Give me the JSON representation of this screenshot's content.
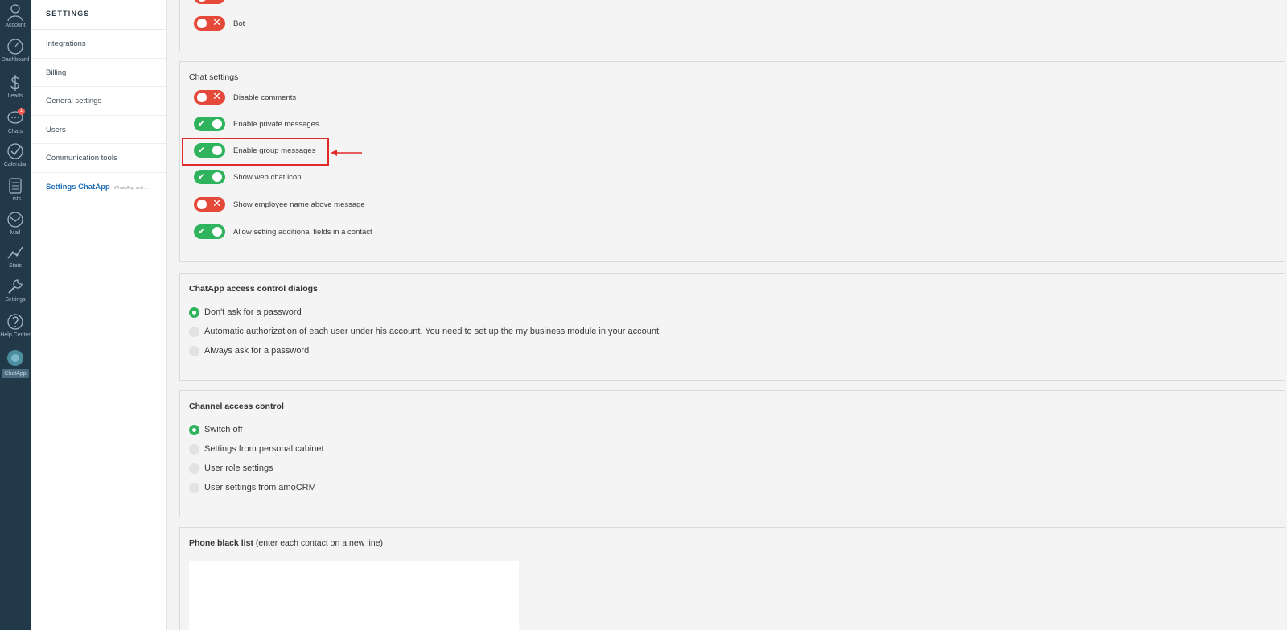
{
  "leftnav": {
    "items": [
      {
        "key": "account",
        "label": "Account",
        "icon": "user-icon"
      },
      {
        "key": "dashboard",
        "label": "Dashboard",
        "icon": "dashboard-gauge-icon"
      },
      {
        "key": "leads",
        "label": "Leads",
        "icon": "dollar-icon"
      },
      {
        "key": "chats",
        "label": "Chats",
        "icon": "chat-bubble-icon",
        "badge": "1"
      },
      {
        "key": "calendar",
        "label": "Calendar",
        "icon": "checkmark-circle-icon"
      },
      {
        "key": "lists",
        "label": "Lists",
        "icon": "list-document-icon"
      },
      {
        "key": "mail",
        "label": "Mail",
        "icon": "envelope-icon"
      },
      {
        "key": "stats",
        "label": "Stats",
        "icon": "line-chart-icon"
      },
      {
        "key": "settings",
        "label": "Settings",
        "icon": "wrench-icon"
      },
      {
        "key": "help",
        "label": "Help Center",
        "icon": "question-icon"
      },
      {
        "key": "chatapp",
        "label": "ChatApp",
        "icon": "chatapp-logo-icon"
      }
    ]
  },
  "sidebar": {
    "title": "SETTINGS",
    "items": [
      {
        "label": "Integrations"
      },
      {
        "label": "Billing"
      },
      {
        "label": "General settings"
      },
      {
        "label": "Users"
      },
      {
        "label": "Communication tools"
      }
    ],
    "active": {
      "label": "Settings ChatApp",
      "sub": "WhatsApp and ..."
    }
  },
  "top_card": {
    "toggles": [
      {
        "label": "Bot",
        "on": false
      }
    ]
  },
  "chat_settings": {
    "title": "Chat settings",
    "toggles": [
      {
        "label": "Disable comments",
        "on": false
      },
      {
        "label": "Enable private messages",
        "on": true
      },
      {
        "label": "Enable group messages",
        "on": true
      },
      {
        "label": "Show web chat icon",
        "on": true
      },
      {
        "label": "Show employee name above message",
        "on": false
      },
      {
        "label": "Allow setting additional fields in a contact",
        "on": true
      }
    ]
  },
  "access_dialogs": {
    "title": "ChatApp access control dialogs",
    "options": [
      {
        "label": "Don't ask for a password",
        "checked": true
      },
      {
        "label": "Automatic authorization of each user under his account. You need to set up the my business module in your account",
        "checked": false
      },
      {
        "label": "Always ask for a password",
        "checked": false
      }
    ]
  },
  "channel_access": {
    "title": "Channel access control",
    "options": [
      {
        "label": "Switch off",
        "checked": true
      },
      {
        "label": "Settings from personal cabinet",
        "checked": false
      },
      {
        "label": "User role settings",
        "checked": false
      },
      {
        "label": "User settings from amoCRM",
        "checked": false
      }
    ]
  },
  "blacklist": {
    "title": "Phone black list",
    "hint": "(enter each contact on a new line)",
    "value": ""
  },
  "colors": {
    "nav_bg": "#22394a",
    "toggle_on": "#2fb35d",
    "toggle_off": "#e5493a",
    "highlight": "#e02b2b",
    "active_link": "#1f6fb8"
  }
}
